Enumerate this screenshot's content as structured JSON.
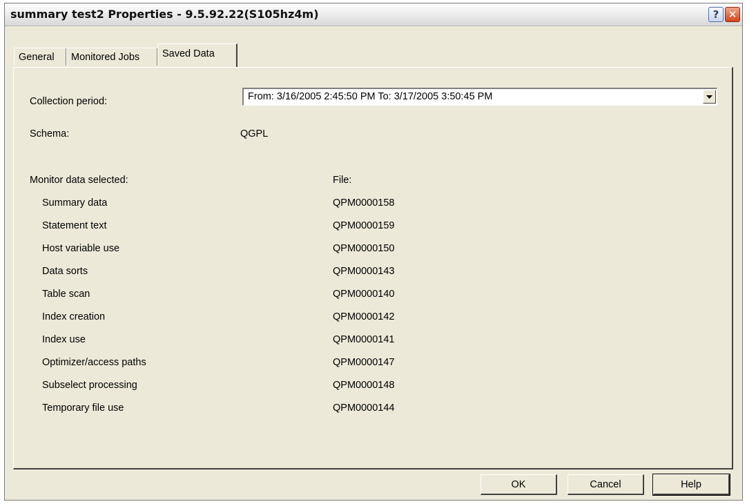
{
  "window": {
    "title": "summary test2 Properties - 9.5.92.22(S105hz4m)",
    "help_glyph": "?",
    "close_glyph": "✕"
  },
  "tabs": [
    {
      "label": "General",
      "active": false
    },
    {
      "label": "Monitored Jobs",
      "active": false
    },
    {
      "label": "Saved Data",
      "active": true
    }
  ],
  "form": {
    "collection_period_label": "Collection period:",
    "collection_period_value": "From:  3/16/2005  2:45:50 PM   To:  3/17/2005  3:50:45 PM",
    "schema_label": "Schema:",
    "schema_value": "QGPL",
    "monitor_data_label": "Monitor data selected:",
    "file_label": "File:"
  },
  "monitor_rows": [
    {
      "name": "Summary data",
      "file": "QPM0000158"
    },
    {
      "name": "Statement text",
      "file": "QPM0000159"
    },
    {
      "name": "Host variable use",
      "file": "QPM0000150"
    },
    {
      "name": "Data sorts",
      "file": "QPM0000143"
    },
    {
      "name": "Table scan",
      "file": "QPM0000140"
    },
    {
      "name": "Index creation",
      "file": "QPM0000142"
    },
    {
      "name": "Index use",
      "file": "QPM0000141"
    },
    {
      "name": "Optimizer/access paths",
      "file": "QPM0000147"
    },
    {
      "name": "Subselect processing",
      "file": "QPM0000148"
    },
    {
      "name": "Temporary file use",
      "file": "QPM0000144"
    }
  ],
  "buttons": {
    "ok": "OK",
    "cancel": "Cancel",
    "help": "Help"
  }
}
